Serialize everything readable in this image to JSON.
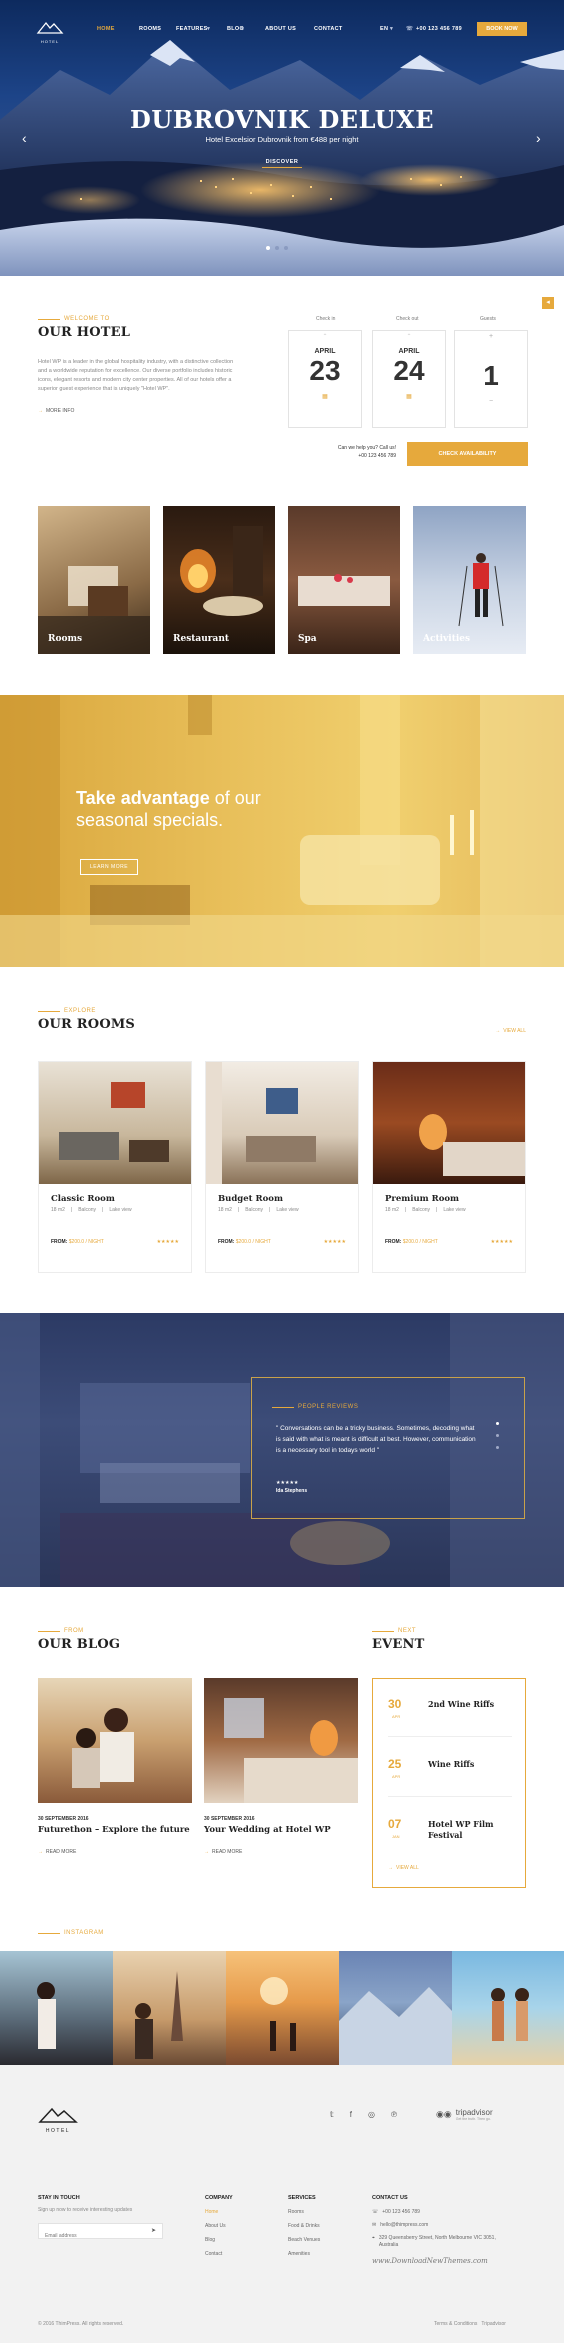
{
  "nav": {
    "logo_text": "HOTEL",
    "items": [
      "HOME",
      "ROOMS",
      "FEATURES",
      "BLOG",
      "ABOUT US",
      "CONTACT"
    ],
    "lang": "EN",
    "phone": "+00 123 456 789",
    "book_label": "BOOK NOW"
  },
  "hero": {
    "title": "DUBROVNIK DELUXE",
    "subtitle": "Hotel Excelsior Dubrovnik from €488 per night",
    "cta": "DISCOVER",
    "prev_icon": "‹",
    "next_icon": "›"
  },
  "welcome": {
    "kicker": "WELCOME TO",
    "title": "OUR HOTEL",
    "body": "Hotel WP is a leader in the global hospitality industry, with a distinctive collection and a worldwide reputation for excellence. Our diverse portfolio includes historic icons, elegant resorts and modern city center properties. All of our hotels offer a superior guest experience that is uniquely \"Hotel WP\".",
    "more": "MORE INFO"
  },
  "booking": {
    "checkin_label": "Check in",
    "checkout_label": "Check out",
    "guests_label": "Guests",
    "checkin_month": "APRIL",
    "checkin_day": "23",
    "checkout_month": "APRIL",
    "checkout_day": "24",
    "guests": "1",
    "help_text": "Can we help you? Call us!",
    "help_phone": "+00 123 456 789",
    "check_label": "CHECK AVAILABILITY"
  },
  "categories": [
    "Rooms",
    "Restaurant",
    "Spa",
    "Activities"
  ],
  "promo": {
    "line1_a": "Take advantage",
    "line1_b": " of our",
    "line2": "seasonal specials.",
    "cta": "LEARN MORE"
  },
  "rooms": {
    "kicker": "EXPLORE",
    "title": "OUR ROOMS",
    "view_all": "VIEW ALL",
    "items": [
      {
        "name": "Classic Room",
        "size": "18 m2",
        "f1": "Balcony",
        "f2": "Lake view",
        "price_label": "FROM:",
        "price": "$200.0 / NIGHT",
        "stars": "★★★★★"
      },
      {
        "name": "Budget Room",
        "size": "18 m2",
        "f1": "Balcony",
        "f2": "Lake view",
        "price_label": "FROM:",
        "price": "$200.0 / NIGHT",
        "stars": "★★★★★"
      },
      {
        "name": "Premium Room",
        "size": "18 m2",
        "f1": "Balcony",
        "f2": "Lake view",
        "price_label": "FROM:",
        "price": "$200.0 / NIGHT",
        "stars": "★★★★★"
      }
    ]
  },
  "reviews": {
    "kicker": "PEOPLE REVIEWS",
    "quote": "\" Conversations can be a tricky business. Sometimes, decoding what is said with what is meant is difficult at best. However, communication is a necessary tool in todays world \"",
    "stars": "★★★★★",
    "author": "Ida Stephens"
  },
  "blog": {
    "kicker": "FROM",
    "title": "OUR BLOG",
    "posts": [
      {
        "date": "30 SEPTEMBER 2016",
        "title": "Futurethon – Explore the future",
        "more": "READ MORE"
      },
      {
        "date": "30 SEPTEMBER 2016",
        "title": "Your Wedding at Hotel WP",
        "more": "READ MORE"
      }
    ]
  },
  "event": {
    "kicker": "NEXT",
    "title": "EVENT",
    "items": [
      {
        "day": "30",
        "month": "APR",
        "name": "2nd Wine Riffs"
      },
      {
        "day": "25",
        "month": "APR",
        "name": "Wine Riffs"
      },
      {
        "day": "07",
        "month": "JAN",
        "name": "Hotel WP Film Festival"
      }
    ],
    "view_all": "VIEW ALL"
  },
  "instagram": {
    "kicker": "INSTAGRAM"
  },
  "footer": {
    "logo_text": "HOTEL",
    "tripadvisor": "tripadvisor",
    "tripadvisor_sub": "Get the truth. Then go.",
    "stay_title": "STAY IN TOUCH",
    "stay_text": "Sign up now to receive interesting updates",
    "email_placeholder": "Email address",
    "company_title": "COMPANY",
    "company_links": [
      "Home",
      "About Us",
      "Blog",
      "Contact"
    ],
    "services_title": "SERVICES",
    "services_links": [
      "Rooms",
      "Food & Drinks",
      "Beach Venues",
      "Amenities"
    ],
    "contact_title": "CONTACT US",
    "contact_phone": "+00 123 456 789",
    "contact_email": "hello@thimpress.com",
    "contact_address": "329 Queensberry Street, North Melbourne VIC 3051, Australia",
    "watermark": "www.DownloadNewThemes.com",
    "copyright": "© 2016 ThimPress. All rights reserved.",
    "bottom_links": "Terms & Conditions   Tripadvisor"
  },
  "colors": {
    "accent": "#e6a93c",
    "dark": "#222222"
  }
}
